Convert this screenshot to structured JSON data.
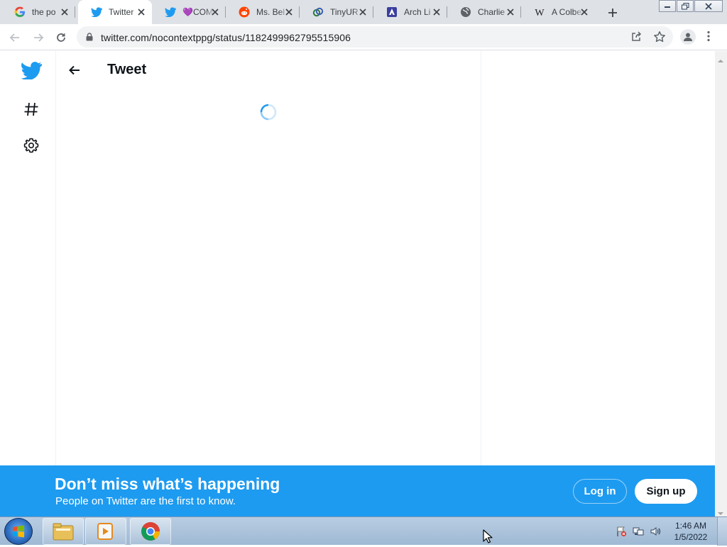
{
  "browser": {
    "tabs": [
      {
        "title": "the po",
        "icon": "google-icon"
      },
      {
        "title": "Twitter",
        "icon": "twitter-icon",
        "active": true
      },
      {
        "title": "💜COM",
        "icon": "twitter-icon"
      },
      {
        "title": "Ms. Bel",
        "icon": "reddit-icon"
      },
      {
        "title": "TinyUR",
        "icon": "tinyurl-icon"
      },
      {
        "title": "Arch Li",
        "icon": "arch-icon"
      },
      {
        "title": "Charlie",
        "icon": "globe-icon"
      },
      {
        "title": "A Colbe",
        "icon": "wikipedia-icon"
      }
    ],
    "url": "twitter.com/nocontextppg/status/1182499962795515906"
  },
  "twitter": {
    "header_title": "Tweet",
    "banner": {
      "headline": "Don’t miss what’s happening",
      "subtext": "People on Twitter are the first to know.",
      "login_label": "Log in",
      "signup_label": "Sign up"
    },
    "colors": {
      "brand": "#1d9bf0"
    }
  },
  "taskbar": {
    "time": "1:46 AM",
    "date": "1/5/2022"
  }
}
